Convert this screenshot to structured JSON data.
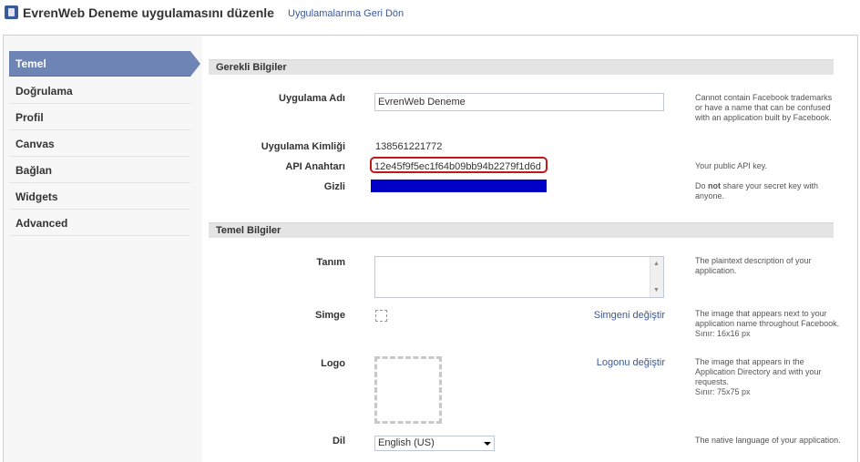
{
  "header": {
    "title": "EvrenWeb Deneme uygulamasını düzenle",
    "back_link": "Uygulamalarıma Geri Dön"
  },
  "sidebar": {
    "items": [
      {
        "label": "Temel",
        "active": true
      },
      {
        "label": "Doğrulama"
      },
      {
        "label": "Profil"
      },
      {
        "label": "Canvas"
      },
      {
        "label": "Bağlan"
      },
      {
        "label": "Widgets"
      },
      {
        "label": "Advanced"
      }
    ]
  },
  "required": {
    "heading": "Gerekli Bilgiler",
    "app_name_label": "Uygulama Adı",
    "app_name_value": "EvrenWeb Deneme",
    "app_name_help": "Cannot contain Facebook trademarks or have a name that can be confused with an application built by Facebook.",
    "app_id_label": "Uygulama Kimliği",
    "app_id_value": "138561221772",
    "api_key_label": "API Anahtarı",
    "api_key_value": "12e45f9f5ec1f64b09bb94b2279f1d6d",
    "api_key_help": "Your public API key.",
    "secret_label": "Gizli",
    "secret_help_pre": "Do ",
    "secret_help_bold": "not",
    "secret_help_post": " share your secret key with anyone."
  },
  "basic": {
    "heading": "Temel Bilgiler",
    "desc_label": "Tanım",
    "desc_value": "",
    "desc_help": "The plaintext description of your application.",
    "icon_label": "Simge",
    "icon_link": "Simgeni değiştir",
    "icon_help": "The image that appears next to your application name throughout Facebook.",
    "icon_limit": "Sınır: 16x16 px",
    "logo_label": "Logo",
    "logo_link": "Logonu değiştir",
    "logo_help": "The image that appears in the Application Directory and with your requests.",
    "logo_limit": "Sınır: 75x75 px",
    "lang_label": "Dil",
    "lang_value": "English (US)",
    "lang_help": "The native language of your application."
  },
  "colors": {
    "brand": "#3b5998",
    "nav_active": "#6d84b4",
    "highlight_border": "#c0191a",
    "secret_mask": "#0000c8"
  }
}
